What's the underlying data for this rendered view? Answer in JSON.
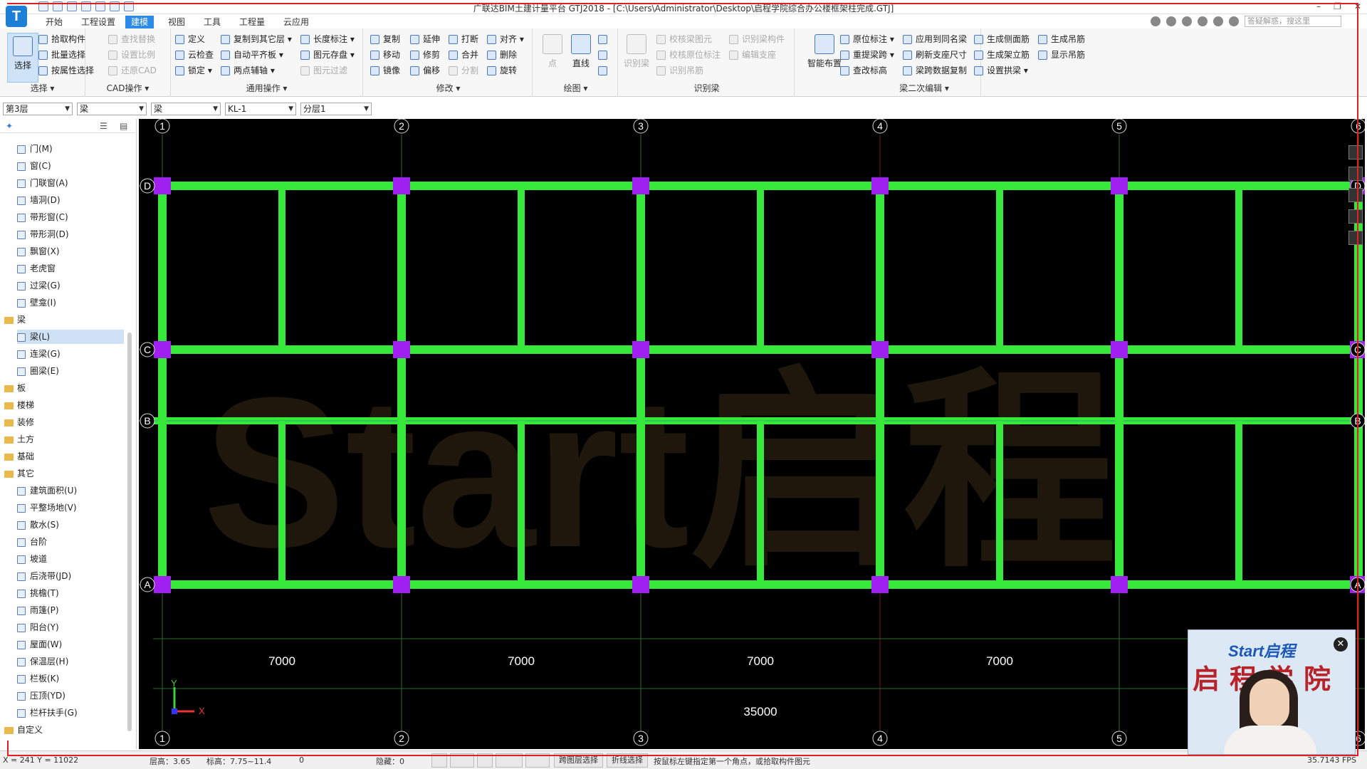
{
  "app": {
    "title": "广联达BIM土建计量平台 GTJ2018 - [C:\\Users\\Administrator\\Desktop\\启程学院综合办公楼框架柱完成.GTJ]",
    "logo_letter": "T",
    "window_controls": [
      "–",
      "❐",
      "✕"
    ]
  },
  "menu": {
    "tabs": [
      "开始",
      "工程设置",
      "建模",
      "视图",
      "工具",
      "工程量",
      "云应用"
    ],
    "active_tab": "建模",
    "help_search_placeholder": "答疑解惑，搜这里"
  },
  "ribbon": {
    "groups": {
      "select": {
        "label": "选择 ▾",
        "big_button": "选择",
        "buttons": [
          "拾取构件",
          "批量选择",
          "按属性选择"
        ]
      },
      "cad": {
        "label": "CAD操作 ▾",
        "buttons": [
          "查找替换",
          "设置比例",
          "还原CAD"
        ]
      },
      "common": {
        "label": "通用操作 ▾",
        "buttons": [
          "定义",
          "复制到其它层 ▾",
          "长度标注 ▾",
          "云检查",
          "自动平齐板 ▾",
          "图元存盘 ▾",
          "锁定 ▾",
          "两点辅轴 ▾",
          "图元过滤"
        ]
      },
      "modify": {
        "label": "修改 ▾",
        "buttons": [
          "复制",
          "延伸",
          "打断",
          "对齐 ▾",
          "移动",
          "修剪",
          "合并",
          "删除",
          "镜像",
          "偏移",
          "分割",
          "旋转"
        ]
      },
      "draw": {
        "label": "绘图 ▾",
        "buttons": [
          "点",
          "直线"
        ]
      },
      "identify": {
        "label": "识别梁",
        "big_button": "识别梁",
        "buttons": [
          "校核梁图元",
          "识别吊筋",
          "校核原位标注",
          "编辑支座",
          "识别梁构件"
        ]
      },
      "beam_edit": {
        "label": "梁二次编辑 ▾",
        "big_button": "智能布置",
        "buttons": [
          "原位标注 ▾",
          "应用到同名梁",
          "生成侧面筋",
          "生成吊筋",
          "重提梁跨 ▾",
          "刷新支座尺寸",
          "生成架立筋",
          "显示吊筋",
          "查改标高",
          "梁跨数据复制",
          "设置拱梁 ▾"
        ]
      }
    }
  },
  "combos": {
    "floor": "第3层",
    "category": "梁",
    "type": "梁",
    "name": "KL-1",
    "layer": "分层1"
  },
  "tree": {
    "items": [
      {
        "kind": "item",
        "label": "门(M)"
      },
      {
        "kind": "item",
        "label": "窗(C)"
      },
      {
        "kind": "item",
        "label": "门联窗(A)"
      },
      {
        "kind": "item",
        "label": "墙洞(D)"
      },
      {
        "kind": "item",
        "label": "带形窗(C)"
      },
      {
        "kind": "item",
        "label": "带形洞(D)"
      },
      {
        "kind": "item",
        "label": "飘窗(X)"
      },
      {
        "kind": "item",
        "label": "老虎窗"
      },
      {
        "kind": "item",
        "label": "过梁(G)"
      },
      {
        "kind": "item",
        "label": "壁龛(I)"
      },
      {
        "kind": "folder",
        "label": "梁"
      },
      {
        "kind": "item",
        "label": "梁(L)",
        "selected": true
      },
      {
        "kind": "item",
        "label": "连梁(G)"
      },
      {
        "kind": "item",
        "label": "圈梁(E)"
      },
      {
        "kind": "folder",
        "label": "板"
      },
      {
        "kind": "folder",
        "label": "楼梯"
      },
      {
        "kind": "folder",
        "label": "装修"
      },
      {
        "kind": "folder",
        "label": "土方"
      },
      {
        "kind": "folder",
        "label": "基础"
      },
      {
        "kind": "folder",
        "label": "其它"
      },
      {
        "kind": "item",
        "label": "建筑面积(U)"
      },
      {
        "kind": "item",
        "label": "平整场地(V)"
      },
      {
        "kind": "item",
        "label": "散水(S)"
      },
      {
        "kind": "item",
        "label": "台阶"
      },
      {
        "kind": "item",
        "label": "坡道"
      },
      {
        "kind": "item",
        "label": "后浇带(JD)"
      },
      {
        "kind": "item",
        "label": "挑檐(T)"
      },
      {
        "kind": "item",
        "label": "雨篷(P)"
      },
      {
        "kind": "item",
        "label": "阳台(Y)"
      },
      {
        "kind": "item",
        "label": "屋面(W)"
      },
      {
        "kind": "item",
        "label": "保温层(H)"
      },
      {
        "kind": "item",
        "label": "栏板(K)"
      },
      {
        "kind": "item",
        "label": "压顶(YD)"
      },
      {
        "kind": "item",
        "label": "栏杆扶手(G)"
      },
      {
        "kind": "folder",
        "label": "自定义"
      }
    ]
  },
  "drawing": {
    "axes_x": [
      "1",
      "2",
      "3",
      "4",
      "5",
      "6"
    ],
    "axes_y": [
      "D",
      "C",
      "B",
      "A"
    ],
    "spans": [
      "7000",
      "7000",
      "7000",
      "7000"
    ],
    "total": "35000",
    "watermark": "Start启程",
    "ucs_x": "X",
    "ucs_y": "Y",
    "colors": {
      "beam": "#35e83a",
      "column": "#a020f0",
      "grid": "#2d6e2d",
      "background": "#000000"
    }
  },
  "status": {
    "coords": "X = 241 Y = 11022",
    "floor_height": "层高：3.65",
    "elevation": "标高：7.75~11.4",
    "value": "0",
    "hidden": "隐藏：0",
    "btn_cross_layer": "跨图层选择",
    "btn_polyline": "折线选择",
    "hint": "按鼠标左键指定第一个角点，或拾取构件图元",
    "fps": "35.7143 FPS"
  },
  "webcam": {
    "brand": "Start启程",
    "calligraphy": "启程学院",
    "close": "✕"
  }
}
